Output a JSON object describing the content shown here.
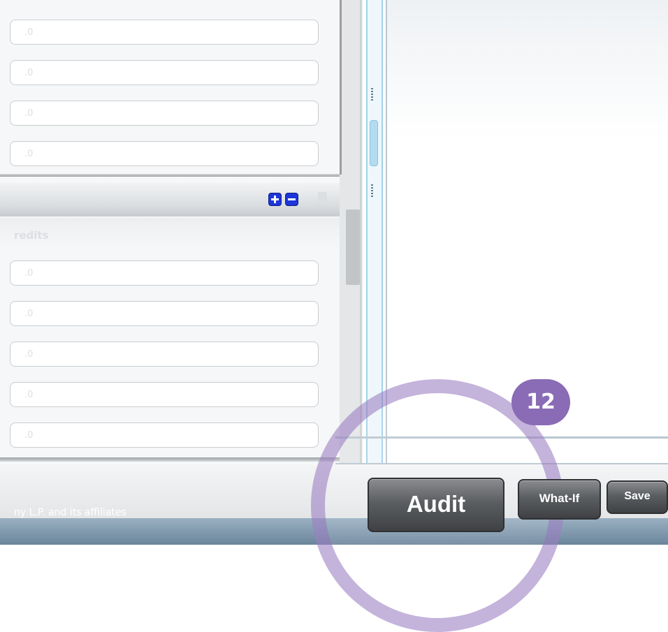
{
  "form": {
    "top_fields": [
      ".0",
      ".0",
      ".0",
      ".0"
    ],
    "section_header": {
      "add_icon": "plus-square-icon",
      "remove_icon": "minus-square-icon",
      "document_icon": "document-icon"
    },
    "column_label": "redits",
    "bottom_fields": [
      ".0",
      ".0",
      ".0",
      ".0",
      ".0"
    ]
  },
  "splitter": {
    "grip_icon": "vertical-grip-icon",
    "collapse_icon": "collapse-handle-icon"
  },
  "toolbar": {
    "audit_label": "Audit",
    "whatif_label": "What-If",
    "save_label": "Save"
  },
  "highlight": {
    "step_number": "12",
    "ring_color": "#9474be"
  },
  "footer": {
    "copyright": "ny L.P. and its affiliates"
  },
  "colors": {
    "accent_blue": "#1c36d9",
    "splitter_blue": "#9fd2ea",
    "badge_purple": "#8a6bb6",
    "footer_blue": "#6a859b"
  }
}
